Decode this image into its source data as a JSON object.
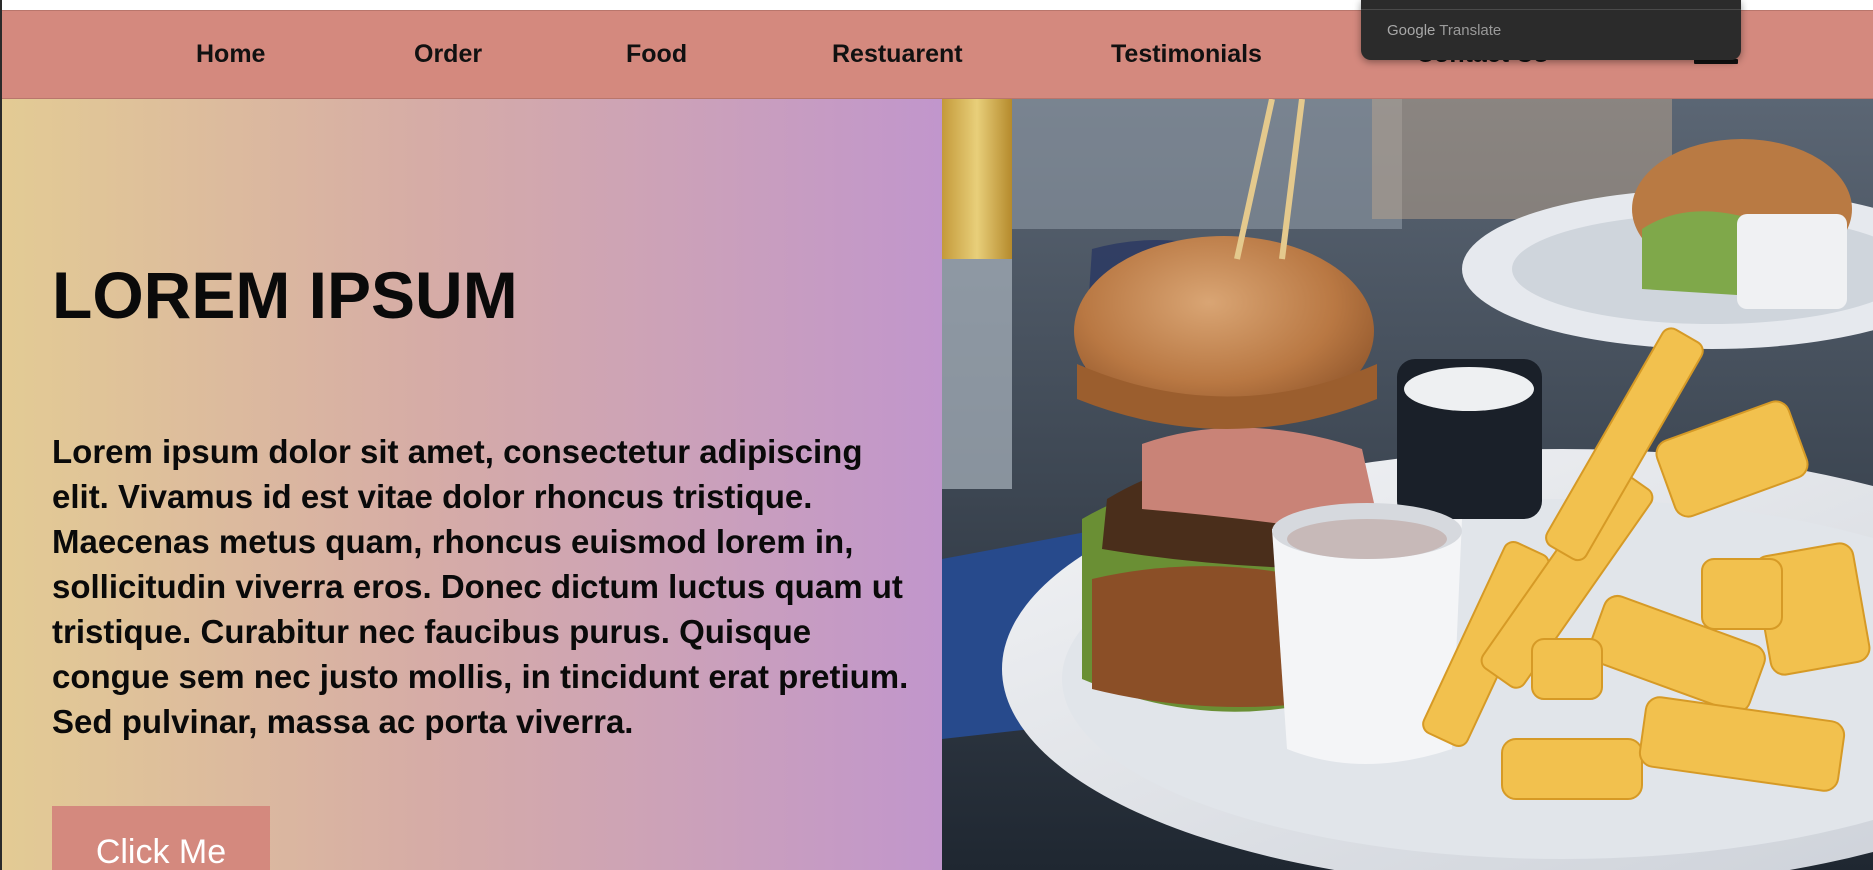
{
  "nav": {
    "items": [
      {
        "label": "Home"
      },
      {
        "label": "Order"
      },
      {
        "label": "Food"
      },
      {
        "label": "Restuarent"
      },
      {
        "label": "Testimonials"
      },
      {
        "label": "Contact Us"
      }
    ],
    "menu_icon": "hamburger-menu-icon"
  },
  "translate_popup": {
    "brand": "Google",
    "product": "Translate"
  },
  "hero": {
    "title": "LOREM IPSUM",
    "body": "Lorem ipsum dolor sit amet, consectetur adipiscing elit. Vivamus id est vitae dolor rhoncus tristique. Maecenas metus quam, rhoncus euismod lorem in, sollicitudin viverra eros. Donec dictum luctus quam ut tristique. Curabitur nec faucibus purus. Quisque congue sem nec justo mollis, in tincidunt erat pretium. Sed pulvinar, massa ac porta viverra.",
    "button_label": "Click Me",
    "image_subject": "burger-and-fries-photo"
  },
  "colors": {
    "nav_background": "#d4897e",
    "button_background": "#d4897e",
    "gradient_start": "#e3cb94",
    "gradient_end": "#c196cc",
    "text": "#0a0a0a"
  }
}
